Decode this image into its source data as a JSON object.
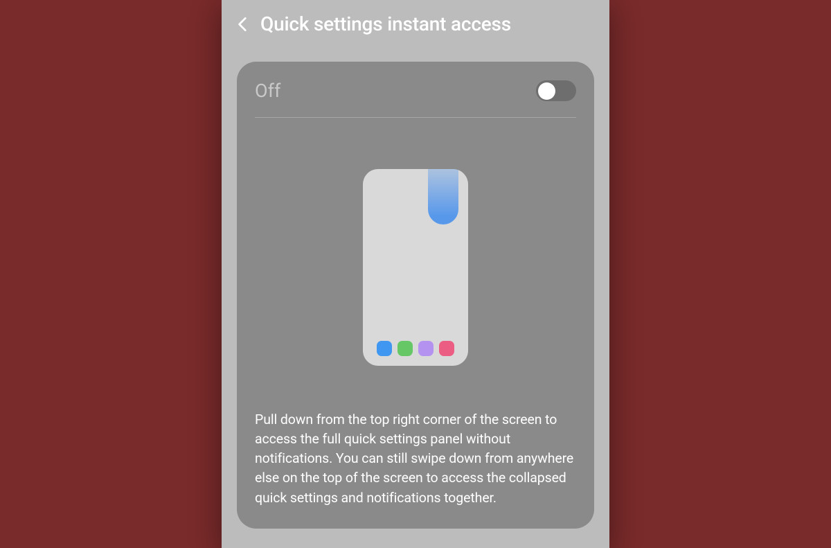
{
  "header": {
    "title": "Quick settings instant access"
  },
  "card": {
    "toggle": {
      "state_label": "Off",
      "enabled": false
    },
    "illustration": {
      "dock_colors": [
        "#3f97f2",
        "#65c766",
        "#b392f0",
        "#ec5d84"
      ]
    },
    "description": "Pull down from the top right corner of the screen to access the full quick settings panel without notifications. You can still swipe down from anywhere else on the top of the screen to access the collapsed quick settings and notifications together."
  }
}
